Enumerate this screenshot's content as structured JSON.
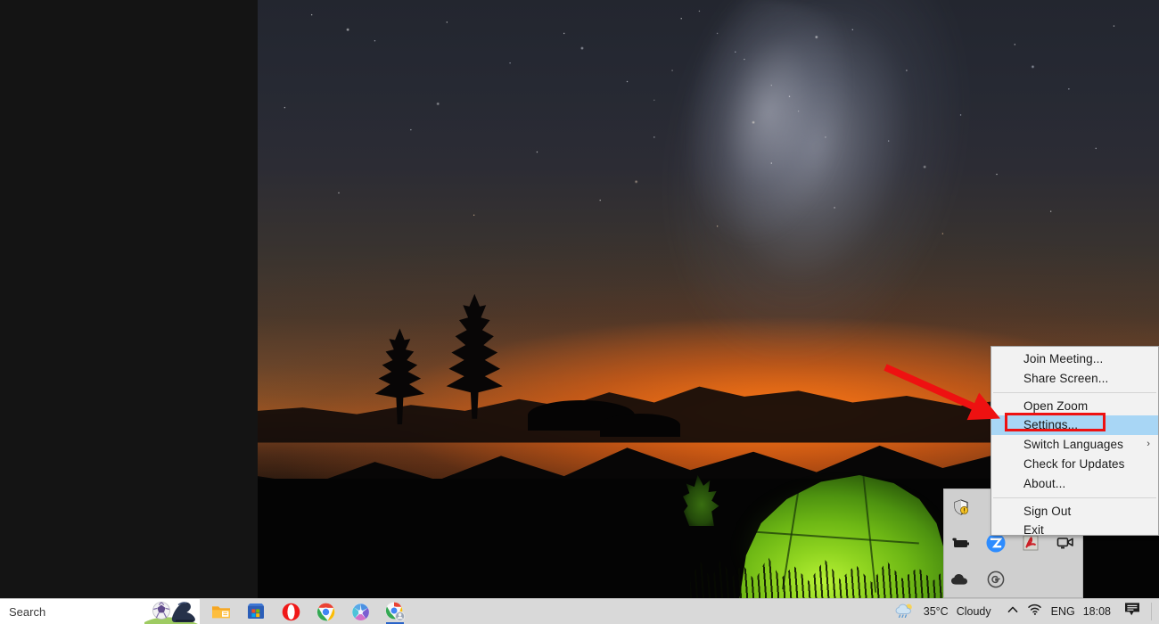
{
  "desktop": {
    "wallpaper_description": "night sky milky way over mountain with glowing green tent",
    "background_color": "#141414"
  },
  "context_menu": {
    "app": "Zoom",
    "items": [
      {
        "label": "Join Meeting...",
        "name": "join-meeting",
        "selected": false,
        "submenu": false,
        "separator_after": false
      },
      {
        "label": "Share Screen...",
        "name": "share-screen",
        "selected": false,
        "submenu": false,
        "separator_after": true
      },
      {
        "label": "Open Zoom",
        "name": "open-zoom",
        "selected": false,
        "submenu": false,
        "separator_after": false
      },
      {
        "label": "Settings...",
        "name": "settings",
        "selected": true,
        "submenu": false,
        "separator_after": false
      },
      {
        "label": "Switch Languages",
        "name": "switch-languages",
        "selected": false,
        "submenu": true,
        "separator_after": false
      },
      {
        "label": "Check for Updates",
        "name": "check-for-updates",
        "selected": false,
        "submenu": false,
        "separator_after": false
      },
      {
        "label": "About...",
        "name": "about",
        "selected": false,
        "submenu": false,
        "separator_after": true
      },
      {
        "label": "Sign Out",
        "name": "sign-out",
        "selected": false,
        "submenu": false,
        "separator_after": false
      },
      {
        "label": "Exit",
        "name": "exit",
        "selected": false,
        "submenu": false,
        "separator_after": false
      }
    ],
    "submenu_arrow_glyph": "›",
    "highlight_color": "#a8d6f5",
    "background_color": "#f2f2f2"
  },
  "annotation": {
    "arrow_color": "#ee1111",
    "highlight_box_color": "#ee1111",
    "points_to": "Settings..."
  },
  "tray_overflow": {
    "background_color": "#cfcfcf",
    "icons": [
      {
        "name": "windows-security-shield-icon",
        "title": "Windows Security"
      },
      {
        "name": "red-app-icon",
        "title": "Red app"
      },
      {
        "name": "empty-slot",
        "title": ""
      },
      {
        "name": "empty-slot",
        "title": ""
      },
      {
        "name": "battery-saver-icon",
        "title": "Battery"
      },
      {
        "name": "zoom-icon",
        "title": "Zoom"
      },
      {
        "name": "adobe-acrobat-icon",
        "title": "Adobe Acrobat"
      },
      {
        "name": "webcam-icon",
        "title": "Camera"
      },
      {
        "name": "onedrive-cloud-icon",
        "title": "OneDrive"
      },
      {
        "name": "grammarly-icon",
        "title": "Grammarly"
      },
      {
        "name": "empty-slot",
        "title": ""
      },
      {
        "name": "empty-slot",
        "title": ""
      }
    ]
  },
  "taskbar": {
    "search": {
      "label": "Search",
      "placeholder": "Search",
      "art": "soccer-ball-and-boot"
    },
    "apps": [
      {
        "name": "taskbar-app-file-explorer",
        "label": "File Explorer",
        "active": false
      },
      {
        "name": "taskbar-app-microsoft-store",
        "label": "Microsoft Store",
        "active": false
      },
      {
        "name": "taskbar-app-opera",
        "label": "Opera",
        "active": false
      },
      {
        "name": "taskbar-app-chrome",
        "label": "Google Chrome",
        "active": false
      },
      {
        "name": "taskbar-app-photos",
        "label": "Photos",
        "active": false
      },
      {
        "name": "taskbar-app-chrome-profile",
        "label": "Google Chrome",
        "active": true
      }
    ],
    "tray": {
      "weather_temperature": "35°C",
      "weather_condition": "Cloudy",
      "weather_icon": "cloud-rain-icon",
      "show_hidden_icons_glyph": "⌃",
      "network_icon": "wifi-icon",
      "language": "ENG",
      "clock": "18:08",
      "notifications_icon": "notification-chat-icon"
    }
  }
}
